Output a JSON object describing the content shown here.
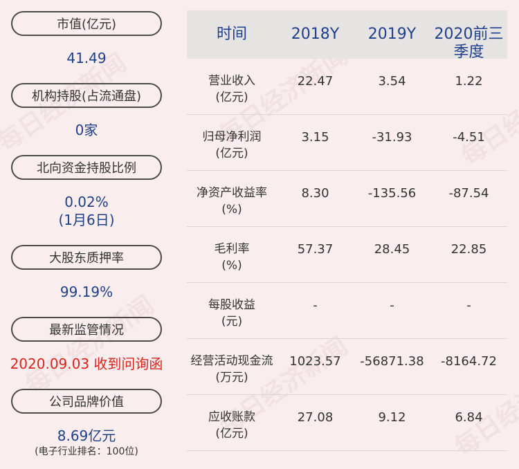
{
  "left": {
    "items": [
      {
        "label": "市值(亿元)",
        "value": "41.49"
      },
      {
        "label": "机构持股(占流通盘)",
        "value": "0家"
      },
      {
        "label": "北向资金持股比例",
        "value": "0.02%",
        "value2": "(1月6日)"
      },
      {
        "label": "大股东质押率",
        "value": "99.19%"
      },
      {
        "label": "最新监管情况",
        "value": "2020.09.03 收到问询函"
      },
      {
        "label": "公司品牌价值",
        "value": "8.69亿元",
        "note": "(电子行业排名：100位)"
      }
    ]
  },
  "table": {
    "headers": [
      "时间",
      "2018Y",
      "2019Y",
      "2020前三季度"
    ],
    "rows": [
      {
        "name": "营业收入",
        "unit": "(亿元)",
        "v1": "22.47",
        "v2": "3.54",
        "v3": "1.22"
      },
      {
        "name": "归母净利润",
        "unit": "(亿元)",
        "v1": "3.15",
        "v2": "-31.93",
        "v3": "-4.51"
      },
      {
        "name": "净资产收益率",
        "unit": "(%)",
        "v1": "8.30",
        "v2": "-135.56",
        "v3": "-87.54"
      },
      {
        "name": "毛利率",
        "unit": "(%)",
        "v1": "57.37",
        "v2": "28.45",
        "v3": "22.85"
      },
      {
        "name": "每股收益",
        "unit": "(元)",
        "v1": "-",
        "v2": "-",
        "v3": "-"
      },
      {
        "name": "经营活动现金流",
        "unit": "(万元)",
        "v1": "1023.57",
        "v2": "-56871.38",
        "v3": "-8164.72"
      },
      {
        "name": "应收账款",
        "unit": "(亿元)",
        "v1": "27.08",
        "v2": "9.12",
        "v3": "6.84"
      }
    ]
  },
  "watermark": "每日经济新闻",
  "colors": {
    "background": "#f9eded",
    "value_blue": "#1f3f8a",
    "alert_red": "#d9251d",
    "header_bg": "#e6e3e3"
  }
}
